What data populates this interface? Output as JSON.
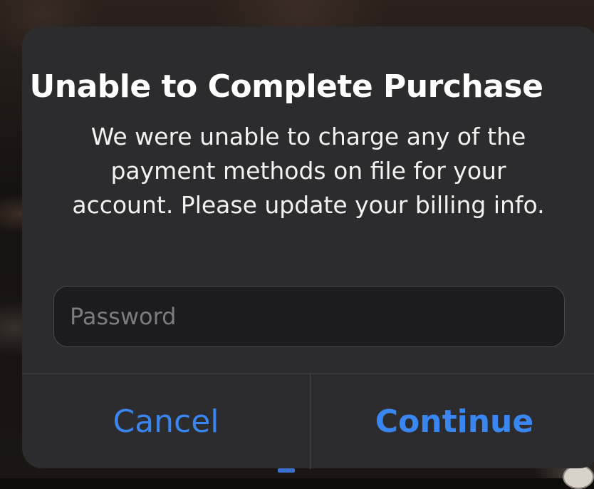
{
  "alert": {
    "title": "Unable to Complete Purchase",
    "message": "We were unable to charge any of the payment methods on file for your account. Please update your billing info.",
    "password_field": {
      "placeholder": "Password",
      "value": ""
    },
    "buttons": {
      "cancel_label": "Cancel",
      "continue_label": "Continue"
    }
  },
  "colors": {
    "accent": "#3a86f0",
    "dialog_background": "#2c2c2e",
    "field_background": "#1c1c1e",
    "separator": "#48484a"
  }
}
